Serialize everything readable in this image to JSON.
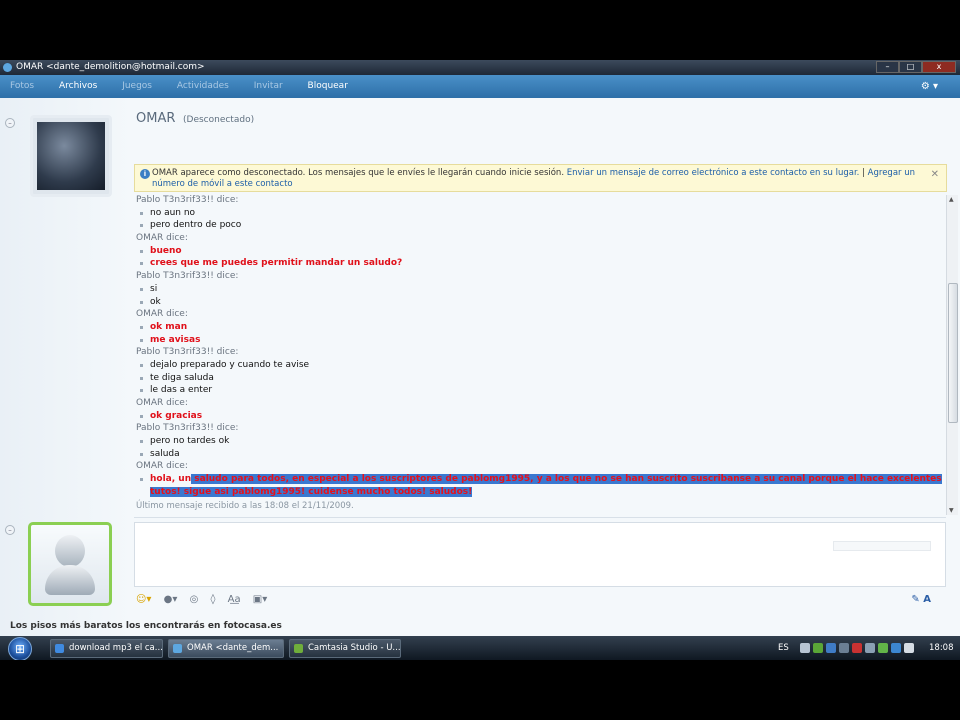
{
  "window": {
    "title": "OMAR <dante_demolition@hotmail.com>",
    "controls": {
      "minimize": "–",
      "maximize": "□",
      "close": "x"
    }
  },
  "menu": {
    "items": [
      "Fotos",
      "Archivos",
      "Juegos",
      "Actividades",
      "Invitar",
      "Bloquear"
    ],
    "gear": "⚙ ▾"
  },
  "contact": {
    "name": "OMAR",
    "status": "(Desconectado)"
  },
  "collapse_glyph": "–",
  "infobar": {
    "icon": "i",
    "text": "OMAR aparece como desconectado. Los mensajes que le envíes le llegarán cuando inicie sesión.",
    "link1": "Enviar un mensaje de correo electrónico a este contacto en su lugar.",
    "separator": "|",
    "link2": "Agregar un número de móvil a este contacto",
    "close": "✕"
  },
  "conversation": [
    {
      "sender": "Pablo    T3n3rif33!! dice:",
      "lines": [
        "no aun no",
        "pero dentro de poco"
      ],
      "style": "normal"
    },
    {
      "sender": "OMAR dice:",
      "lines": [
        "bueno",
        "crees que me puedes permitir mandar un saludo?"
      ],
      "style": "red"
    },
    {
      "sender": "Pablo    T3n3rif33!! dice:",
      "lines": [
        "si",
        "ok"
      ],
      "style": "normal"
    },
    {
      "sender": "OMAR dice:",
      "lines": [
        "ok man",
        "me avisas"
      ],
      "style": "red"
    },
    {
      "sender": "Pablo    T3n3rif33!! dice:",
      "lines": [
        "dejalo preparado y cuando te avise",
        "te diga saluda",
        "le das a enter"
      ],
      "style": "normal"
    },
    {
      "sender": "OMAR dice:",
      "lines": [
        "ok gracias"
      ],
      "style": "red"
    },
    {
      "sender": "Pablo    T3n3rif33!! dice:",
      "lines": [
        "pero no tardes ok",
        "saluda"
      ],
      "style": "normal"
    }
  ],
  "last_message": {
    "sender": "OMAR dice:",
    "prefix": "hola, un",
    "highlighted": " saludo para todos, en especial a los suscriptores de pablomg1995, y a los que no se han suscrito suscribanse a su canal porque el hace excelentes tutos! sigue asi pablomg1995! cuidense mucho todos! saludos!"
  },
  "last_received": "Último mensaje recibido a las 18:08 el 21/11/2009.",
  "ad_text": "Los pisos más baratos los encontrarás en fotocasa.es",
  "taskbar": {
    "start": "⊞",
    "tasks": [
      "download mp3 el ca...",
      "OMAR <dante_dem...",
      "Camtasia Studio - U..."
    ],
    "language": "ES",
    "clock": "18:08"
  },
  "colors": {
    "menu_bar": "#2d6fa8",
    "user_message": "#e0101a",
    "selection": "#3a78d0",
    "link": "#1c5ea8"
  }
}
